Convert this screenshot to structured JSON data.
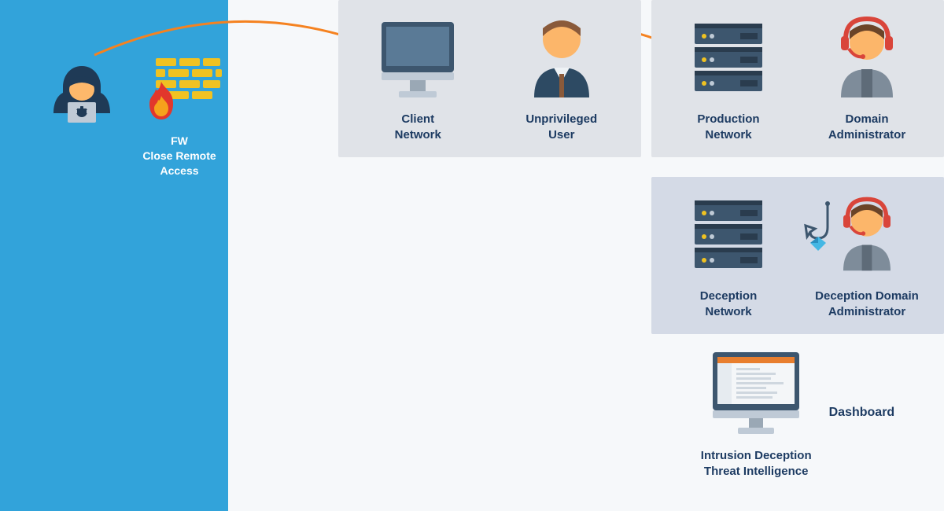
{
  "firewall": {
    "label": "FW\nClose Remote\nAccess"
  },
  "client": {
    "node_a": "Client\nNetwork",
    "node_b": "Unprivileged\nUser"
  },
  "production": {
    "node_a": "Production\nNetwork",
    "node_b": "Domain\nAdministrator"
  },
  "deception": {
    "node_a": "Deception\nNetwork",
    "node_b": "Deception Domain\nAdministrator"
  },
  "dashboard": {
    "title": "Dashboard",
    "subtitle": "Intrusion Deception\nThreat Intelligence"
  }
}
